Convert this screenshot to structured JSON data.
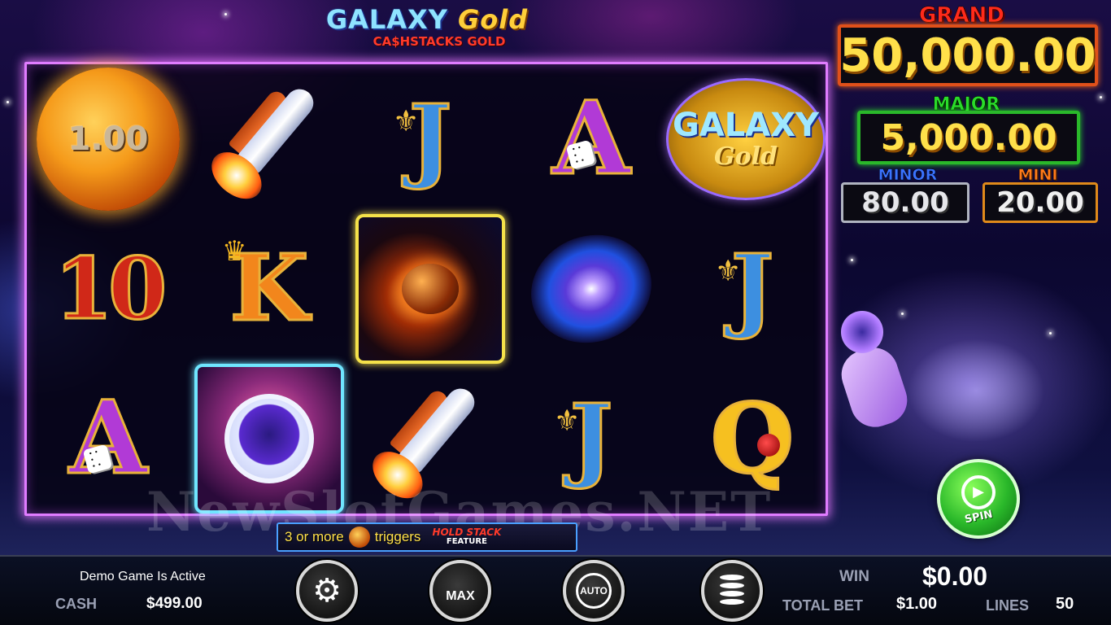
{
  "logo": {
    "line1_a": "GALAXY",
    "line1_b": "Gold",
    "line2": "CA$HSTACKS GOLD"
  },
  "jackpots": {
    "grand": {
      "label": "GRAND",
      "value": "50,000.00",
      "color": "#ff2a1a"
    },
    "major": {
      "label": "MAJOR",
      "value": "5,000.00",
      "color": "#2adc2a"
    },
    "minor": {
      "label": "MINOR",
      "value": "80.00",
      "color": "#3a72ff"
    },
    "mini": {
      "label": "MINI",
      "value": "20.00",
      "color": "#ff7a1a"
    }
  },
  "reels": {
    "symbols": {
      "r0": [
        "moon-bonus",
        "ten",
        "ace"
      ],
      "r1": [
        "rocket",
        "king",
        "astronaut"
      ],
      "r2": [
        "jack",
        "meteor",
        "rocket"
      ],
      "r3": [
        "ace",
        "galaxy",
        "jack"
      ],
      "r4": [
        "wild-galaxy-gold",
        "jack",
        "queen"
      ]
    },
    "moon_value": "1.00",
    "labels": {
      "ten": "10",
      "king": "K",
      "jack": "J",
      "ace": "A",
      "queen": "Q"
    },
    "wild_line1": "GALAXY",
    "wild_line2": "Gold"
  },
  "feature_banner": {
    "text_before": "3 or more",
    "text_after": "triggers",
    "badge_line1": "HOLD STACK",
    "badge_line2": "FEATURE"
  },
  "watermark": "NewSlotGames.NET",
  "spin": {
    "label": "SPIN"
  },
  "bottom": {
    "status": "Demo Game Is Active",
    "cash_label": "CASH",
    "cash_value": "$499.00",
    "max_label": "MAX",
    "auto_label": "AUTO",
    "win_label": "WIN",
    "win_value": "$0.00",
    "total_bet_label": "TOTAL BET",
    "total_bet_value": "$1.00",
    "lines_label": "LINES",
    "lines_value": "50"
  },
  "icons": [
    "gear-icon",
    "max-bet-icon",
    "autoplay-icon",
    "coin-stack-icon",
    "spin-play-icon"
  ]
}
